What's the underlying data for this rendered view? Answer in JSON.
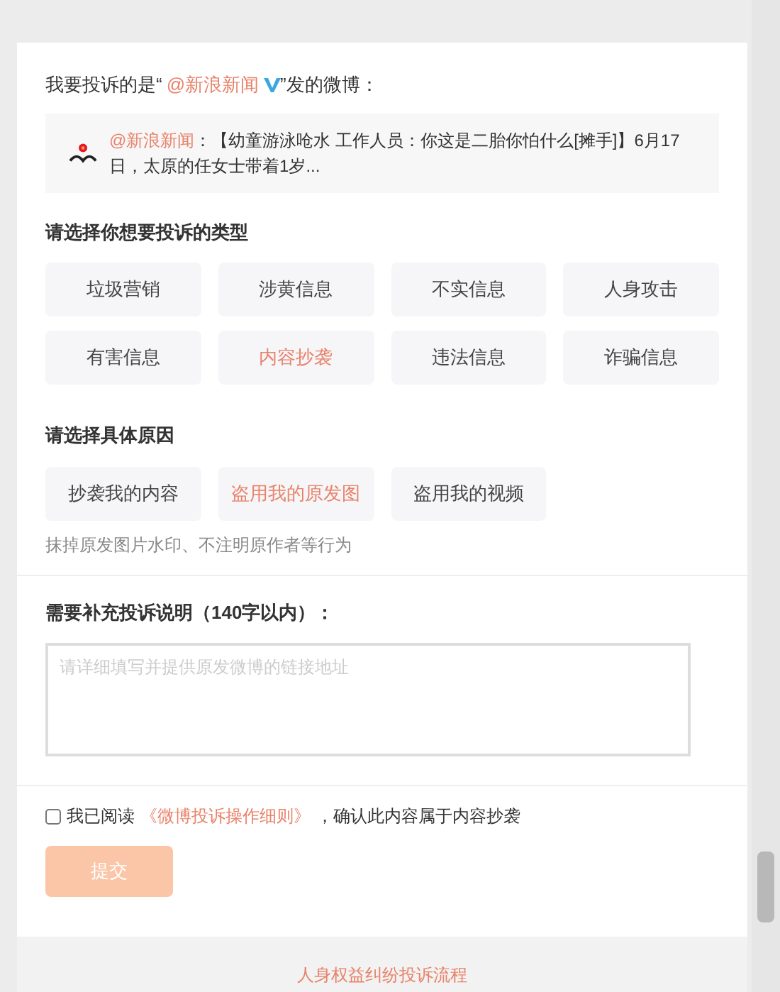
{
  "header": {
    "prefix": "我要投诉的是“",
    "account": "@新浪新闻",
    "suffix": "”发的微博："
  },
  "post": {
    "author": "@新浪新闻",
    "separator": "：",
    "text": "【幼童游泳呛水 工作人员：你这是二胎你怕什么[摊手]】6月17日，太原的任女士带着1岁..."
  },
  "type_section": {
    "title": "请选择你想要投诉的类型",
    "options": [
      {
        "label": "垃圾营销",
        "selected": false
      },
      {
        "label": "涉黄信息",
        "selected": false
      },
      {
        "label": "不实信息",
        "selected": false
      },
      {
        "label": "人身攻击",
        "selected": false
      },
      {
        "label": "有害信息",
        "selected": false
      },
      {
        "label": "内容抄袭",
        "selected": true
      },
      {
        "label": "违法信息",
        "selected": false
      },
      {
        "label": "诈骗信息",
        "selected": false
      }
    ]
  },
  "reason_section": {
    "title": "请选择具体原因",
    "options": [
      {
        "label": "抄袭我的内容",
        "selected": false
      },
      {
        "label": "盗用我的原发图",
        "selected": true
      },
      {
        "label": "盗用我的视频",
        "selected": false
      }
    ],
    "hint": "抹掉原发图片水印、不注明原作者等行为"
  },
  "note_section": {
    "title": "需要补充投诉说明（140字以内）：",
    "placeholder": "请详细填写并提供原发微博的链接地址"
  },
  "agreement": {
    "checked": false,
    "prefix": "我已阅读",
    "link": "《微博投诉操作细则》",
    "suffix": "，确认此内容属于内容抄袭"
  },
  "submit": {
    "label": "提交",
    "disabled": true
  },
  "footer": {
    "link": "人身权益纠纷投诉流程"
  }
}
